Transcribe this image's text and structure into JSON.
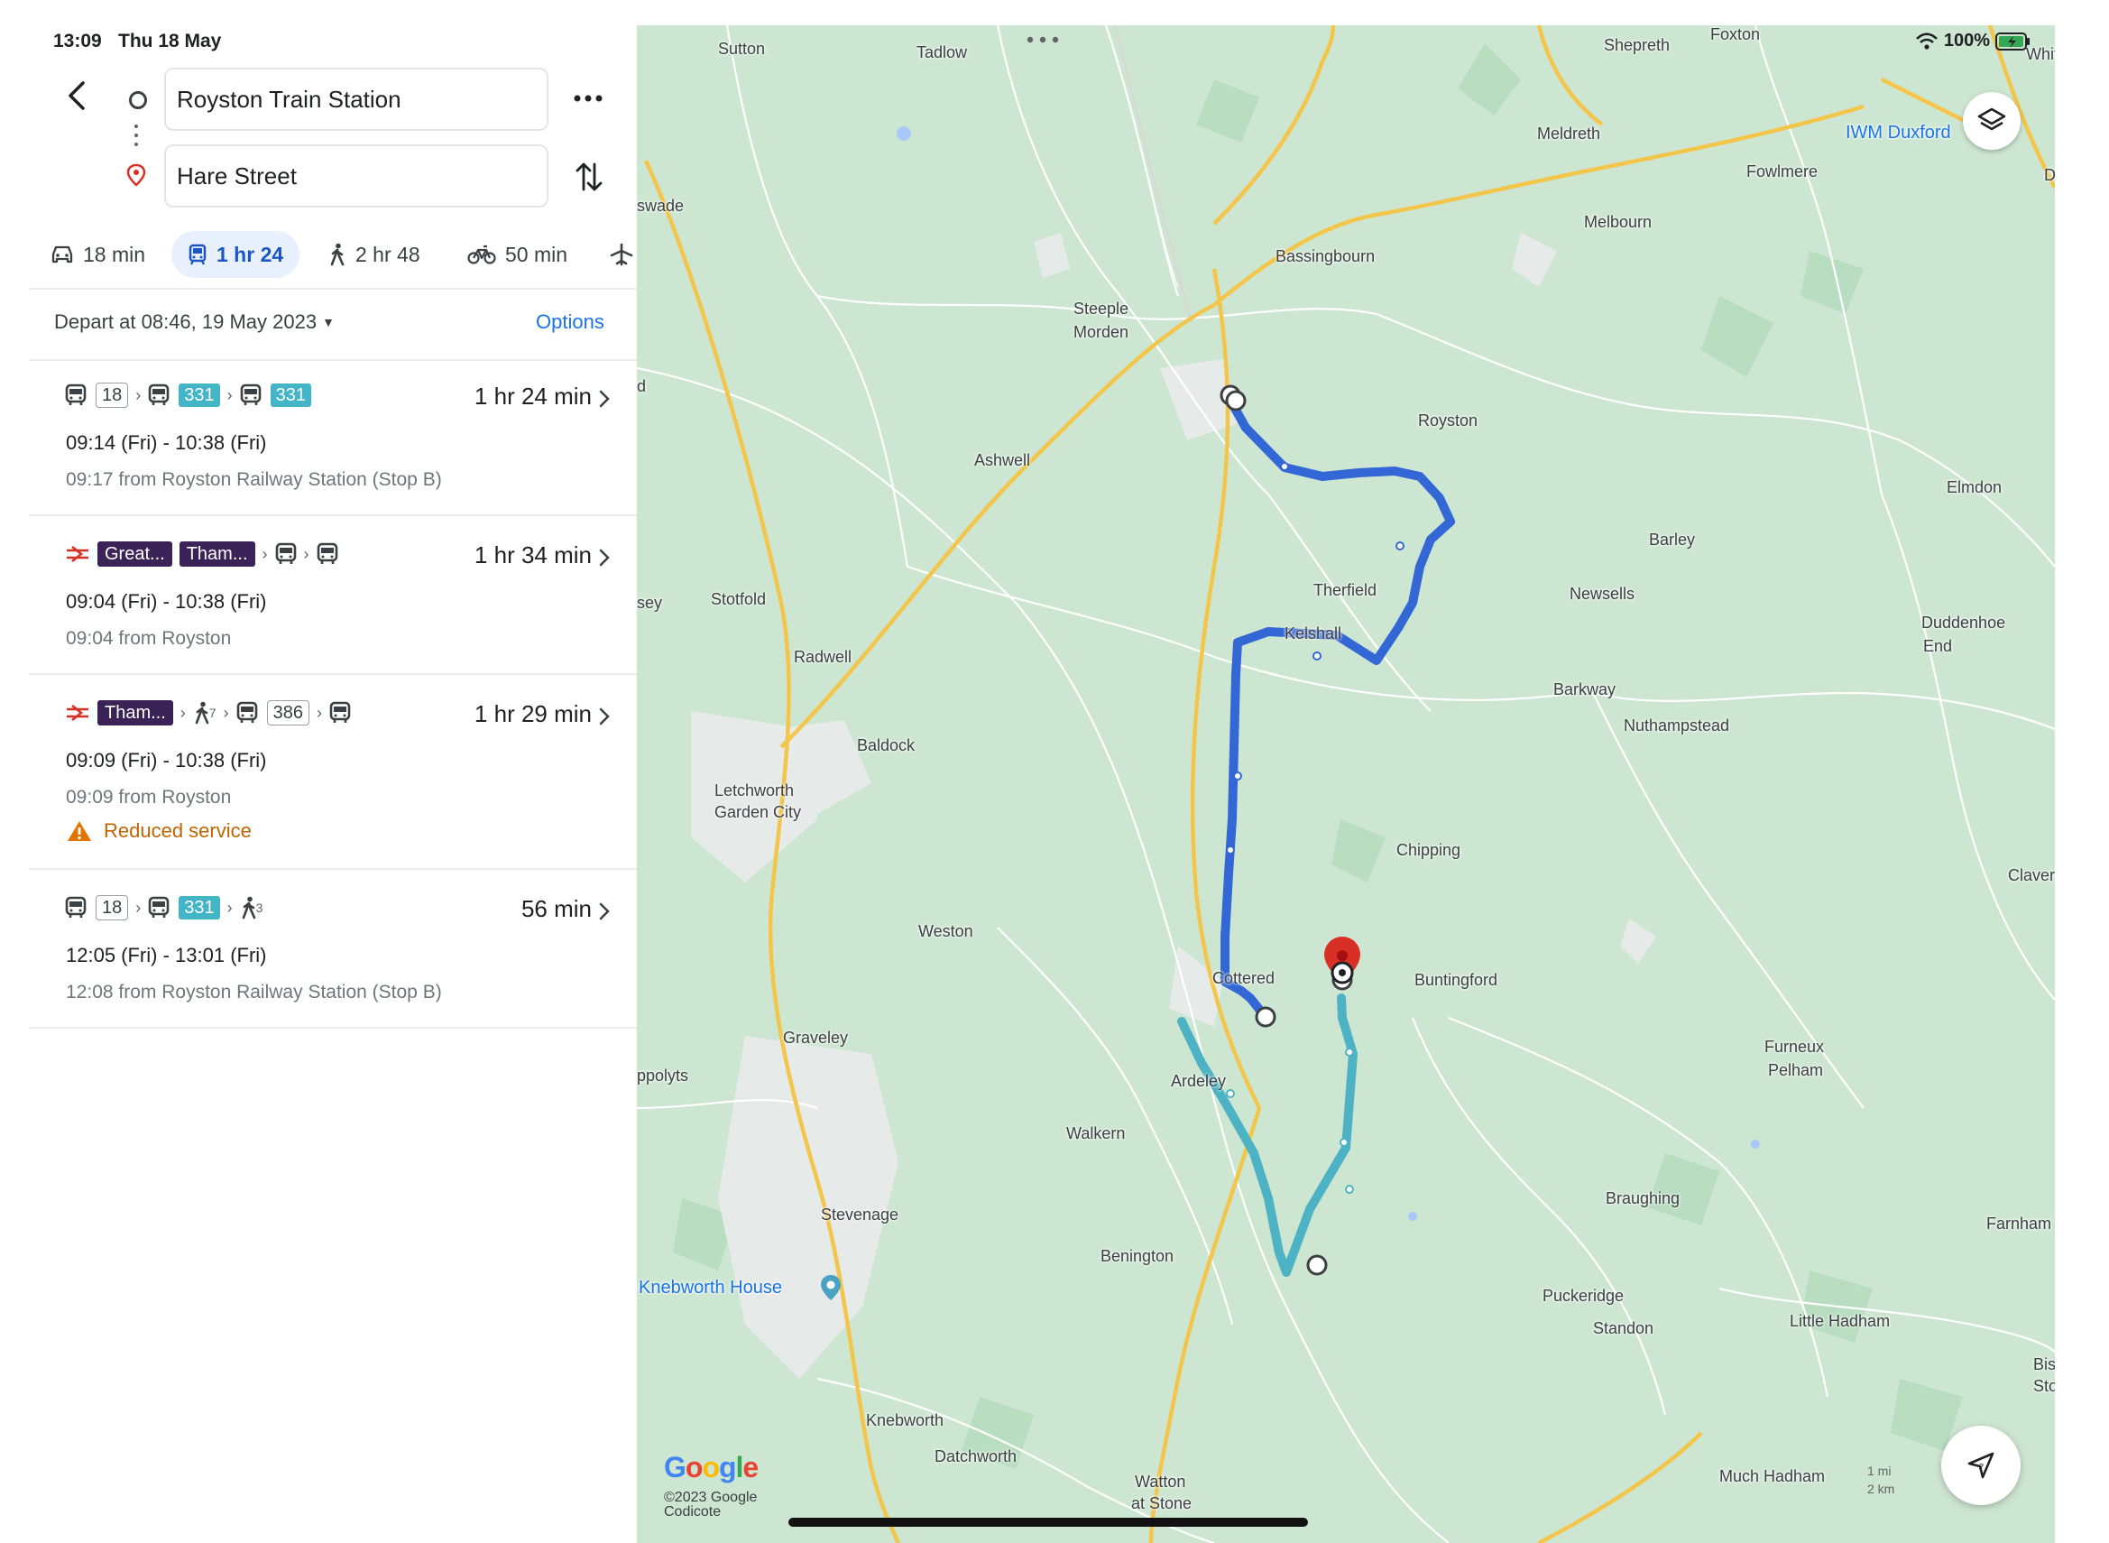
{
  "status_bar": {
    "time": "13:09",
    "date": "Thu 18 May",
    "battery": "100%"
  },
  "search": {
    "origin": "Royston Train Station",
    "destination": "Hare Street"
  },
  "modes": [
    {
      "name": "drive",
      "label": "18 min"
    },
    {
      "name": "transit",
      "label": "1 hr 24",
      "selected": true
    },
    {
      "name": "walk",
      "label": "2 hr 48"
    },
    {
      "name": "cycle",
      "label": "50 min"
    }
  ],
  "depart": {
    "label": "Depart at 08:46, 19 May 2023",
    "options_label": "Options"
  },
  "trips": [
    {
      "route_badges": [
        "18",
        "331",
        "331"
      ],
      "duration": "1 hr 24 min",
      "times": "09:14 (Fri) - 10:38 (Fri)",
      "from": "09:17 from Royston Railway Station (Stop B)"
    },
    {
      "route_badges": [
        "Great...",
        "Tham..."
      ],
      "duration": "1 hr 34 min",
      "times": "09:04 (Fri) - 10:38 (Fri)",
      "from": "09:04 from Royston"
    },
    {
      "route_badges": [
        "Tham...",
        "7",
        "386"
      ],
      "duration": "1 hr 29 min",
      "times": "09:09 (Fri) - 10:38 (Fri)",
      "from": "09:09 from Royston",
      "warning": "Reduced service"
    },
    {
      "route_badges": [
        "18",
        "331",
        "3"
      ],
      "duration": "56 min",
      "times": "12:05 (Fri) - 13:01 (Fri)",
      "from": "12:08 from Royston Railway Station (Stop B)"
    }
  ],
  "map": {
    "labels": [
      "Sutton",
      "Tadlow",
      "Shepreth",
      "Foxton",
      "Whit",
      "IWM Duxford",
      "Meldreth",
      "Fowlmere",
      "D",
      "swade",
      "Melbourn",
      "Bassingbourn",
      "Steeple",
      "Morden",
      "Royston",
      "d",
      "Ashwell",
      "Elmdon",
      "Therfield",
      "Barley",
      "Newsells",
      "Stotfold",
      "sey",
      "Kelshall",
      "Duddenhoe",
      "End",
      "Radwell",
      "Barkway",
      "Nuthampstead",
      "Baldock",
      "Letchworth",
      "Garden City",
      "Chipping",
      "Clavering",
      "Weston",
      "Cottered",
      "Buntingford",
      "Furneux",
      "Pelham",
      "Graveley",
      "ppolyts",
      "Ardeley",
      "Walkern",
      "Stevenage",
      "Braughing",
      "Farnham",
      "Benington",
      "Knebworth House",
      "Puckeridge",
      "Standon",
      "Little Hadham",
      "Bish",
      "Stor",
      "Knebworth",
      "Datchworth",
      "Watton",
      "at Stone",
      "Much Hadham"
    ],
    "google": "Google",
    "copyright_line1": "©2023 Google",
    "copyright_line2": "Codicote",
    "scale_line1": "1 mi",
    "scale_line2": "2 km",
    "colors": {
      "route_blue": "#3367d6",
      "route_teal": "#4db3c4",
      "road_yellow": "#f3c54b",
      "land": "#cde6d1"
    }
  }
}
